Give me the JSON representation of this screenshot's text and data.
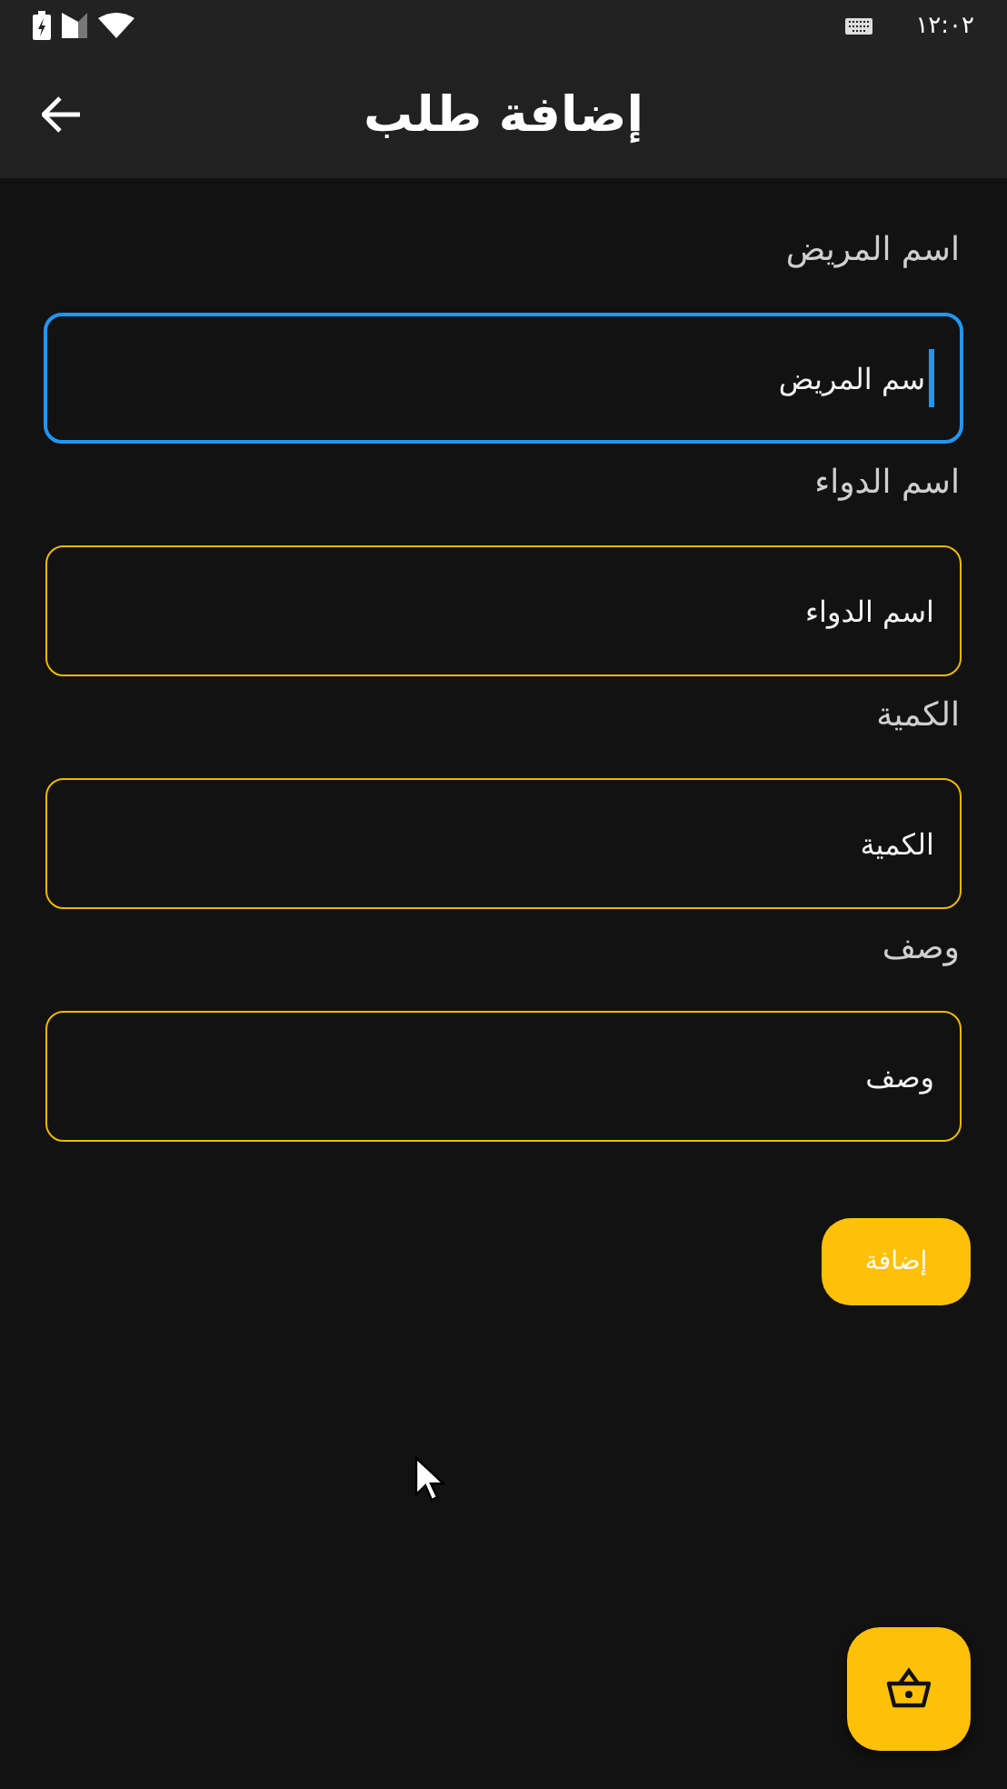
{
  "status_bar": {
    "time": "١٢:٠٢"
  },
  "app_bar": {
    "title": "إضافة طلب"
  },
  "fields": [
    {
      "label": "اسم المريض",
      "placeholder": "سم المريض",
      "focused": true
    },
    {
      "label": "اسم الدواء",
      "placeholder": "اسم الدواء",
      "focused": false
    },
    {
      "label": "الكمية",
      "placeholder": "الكمية",
      "focused": false
    },
    {
      "label": "وصف",
      "placeholder": "وصف",
      "focused": false
    }
  ],
  "submit_button": {
    "label": "إضافة"
  }
}
